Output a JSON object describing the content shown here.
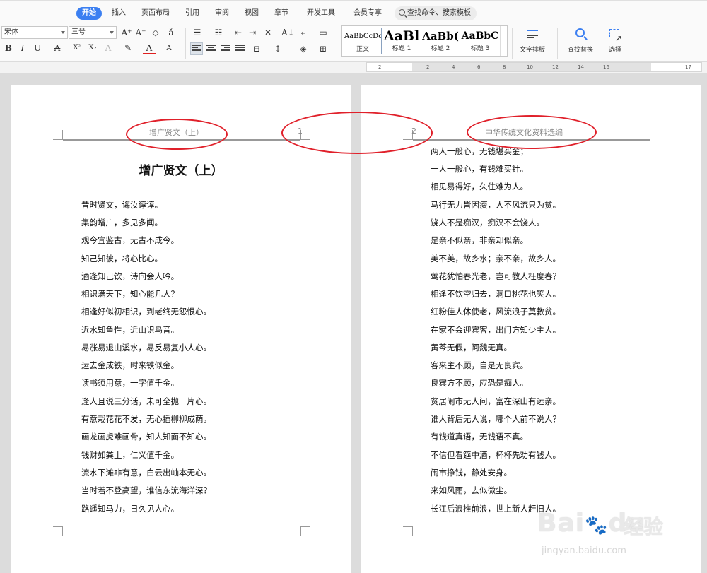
{
  "menu": {
    "tabs": [
      "开始",
      "插入",
      "页面布局",
      "引用",
      "审阅",
      "视图",
      "章节",
      "开发工具",
      "会员专享"
    ],
    "active_tab": "开始",
    "search_placeholder": "查找命令、搜索模板"
  },
  "ribbon": {
    "font_name": "宋体",
    "font_size": "三号",
    "styles": [
      {
        "sample": "AaBbCcDd",
        "label": "正文"
      },
      {
        "sample": "AaBl",
        "label": "标题 1"
      },
      {
        "sample": "AaBb(",
        "label": "标题 2"
      },
      {
        "sample": "AaBbC",
        "label": "标题 3"
      }
    ],
    "text_layout_label": "文字排版",
    "find_replace_label": "查找替换",
    "select_label": "选择"
  },
  "ruler": {
    "ticks": [
      "2",
      "2",
      "4",
      "6",
      "8",
      "10",
      "12",
      "14",
      "16",
      "17"
    ]
  },
  "pages": {
    "left": {
      "header": "增广贤文（上）",
      "page_number": "1",
      "title": "增广贤文（上）",
      "lines": [
        "昔时贤文，诲汝谆谆。",
        "集韵增广，多见多闻。",
        "观今宜鉴古，无古不成今。",
        "知己知彼，将心比心。",
        "酒逢知己饮，诗向会人吟。",
        "相识满天下，知心能几人？",
        "相逢好似初相识，到老终无怨恨心。",
        "近水知鱼性，近山识鸟音。",
        "易涨易退山溪水，易反易复小人心。",
        "运去金成铁，时来铁似金。",
        "读书须用意，一字值千金。",
        "逢人且说三分话，未可全抛一片心。",
        "有意栽花花不发，无心插柳柳成荫。",
        "画龙画虎难画骨，知人知面不知心。",
        "钱财如粪土，仁义值千金。",
        "流水下滩非有意，白云出岫本无心。",
        "当时若不登高望，谁信东流海洋深？",
        "路遥知马力，日久见人心。"
      ]
    },
    "right": {
      "header": "中华传统文化资料选编",
      "page_number": "2",
      "lines": [
        "两人一般心，无钱堪买金；",
        "一人一般心，有钱难买针。",
        "相见易得好，久住难为人。",
        "马行无力皆因瘦，人不风流只为贫。",
        "饶人不是痴汉，痴汉不会饶人。",
        "是亲不似亲，非亲却似亲。",
        "美不美，故乡水；亲不亲，故乡人。",
        "莺花犹怕春光老，岂可教人枉度春？",
        "相逢不饮空归去，洞口桃花也笑人。",
        "红粉佳人休使老，风流浪子莫教贫。",
        "在家不会迎宾客，出门方知少主人。",
        "黄芩无假，阿魏无真。",
        "客来主不顾，自是无良宾。",
        "良宾方不顾，应恐是痴人。",
        "贫居闹市无人问，富在深山有远亲。",
        "谁人背后无人说，哪个人前不说人？",
        "有钱道真语，无钱语不真。",
        "不信但看筵中酒，杯杯先劝有钱人。",
        "闹市挣钱，静处安身。",
        "来如风雨，去似微尘。",
        "长江后浪推前浪，世上新人赶旧人。"
      ]
    }
  },
  "watermark": {
    "brand": "Bai",
    "brand_suffix": "du",
    "cn": "经验",
    "url": "jingyan.baidu.com"
  },
  "colors": {
    "accent": "#3b7ff1",
    "annotation": "#e0202a",
    "page_bg": "#ffffff",
    "workspace_bg": "#dcdcdc"
  }
}
